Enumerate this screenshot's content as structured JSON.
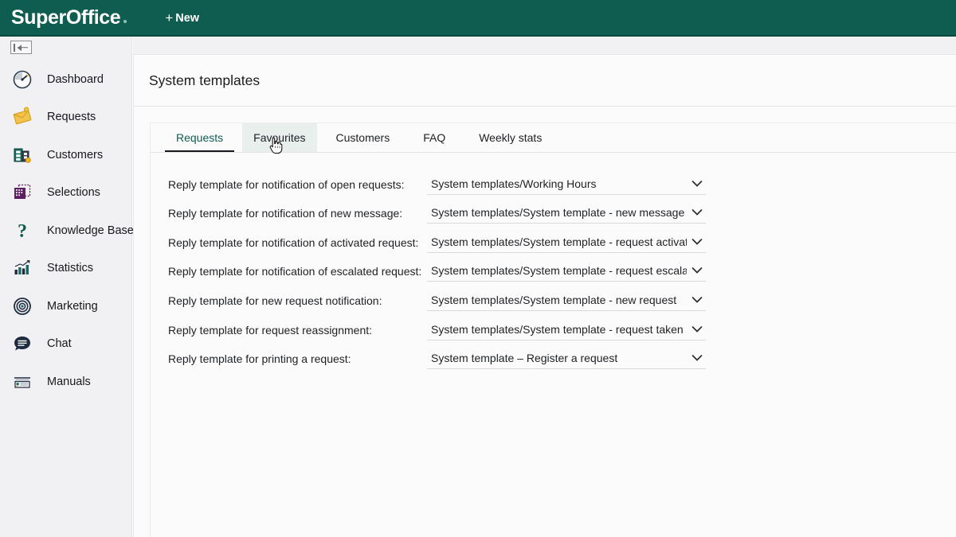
{
  "header": {
    "brand": "SuperOffice",
    "new_label": "New",
    "new_plus": "+"
  },
  "sidebar": {
    "collapse_icon": "collapse-panel-icon",
    "items": [
      {
        "label": "Dashboard",
        "icon": "gauge-icon"
      },
      {
        "label": "Requests",
        "icon": "ticket-icon"
      },
      {
        "label": "Customers",
        "icon": "building-icon"
      },
      {
        "label": "Selections",
        "icon": "selection-grid-icon"
      },
      {
        "label": "Knowledge Base",
        "icon": "question-mark-icon"
      },
      {
        "label": "Statistics",
        "icon": "bar-chart-icon"
      },
      {
        "label": "Marketing",
        "icon": "target-icon"
      },
      {
        "label": "Chat",
        "icon": "chat-bubble-icon"
      },
      {
        "label": "Manuals",
        "icon": "manual-page-icon"
      }
    ]
  },
  "main": {
    "page_title": "System templates",
    "tabs": [
      {
        "label": "Requests",
        "active": true,
        "hovered": false
      },
      {
        "label": "Favourites",
        "active": false,
        "hovered": true
      },
      {
        "label": "Customers",
        "active": false,
        "hovered": false
      },
      {
        "label": "FAQ",
        "active": false,
        "hovered": false
      },
      {
        "label": "Weekly stats",
        "active": false,
        "hovered": false
      }
    ],
    "rows": [
      {
        "label": "Reply template for notification of open requests:",
        "value": "System templates/Working Hours"
      },
      {
        "label": "Reply template for notification of new message:",
        "value": "System templates/System template - new message"
      },
      {
        "label": "Reply template for notification of activated request:",
        "value": "System templates/System template - request activated"
      },
      {
        "label": "Reply template for notification of escalated request:",
        "value": "System templates/System template - request escalated"
      },
      {
        "label": "Reply template for new request notification:",
        "value": "System templates/System template - new request"
      },
      {
        "label": "Reply template for request reassignment:",
        "value": "System templates/System template - request taken ove"
      },
      {
        "label": "Reply template for printing a request:",
        "value": "System template – Register a request"
      }
    ]
  },
  "colors": {
    "brand_teal": "#0f5d50",
    "sidebar_bg": "#f1f1f3",
    "active_tab_text": "#0f5d50",
    "hovered_tab_bg": "#e9efed"
  }
}
